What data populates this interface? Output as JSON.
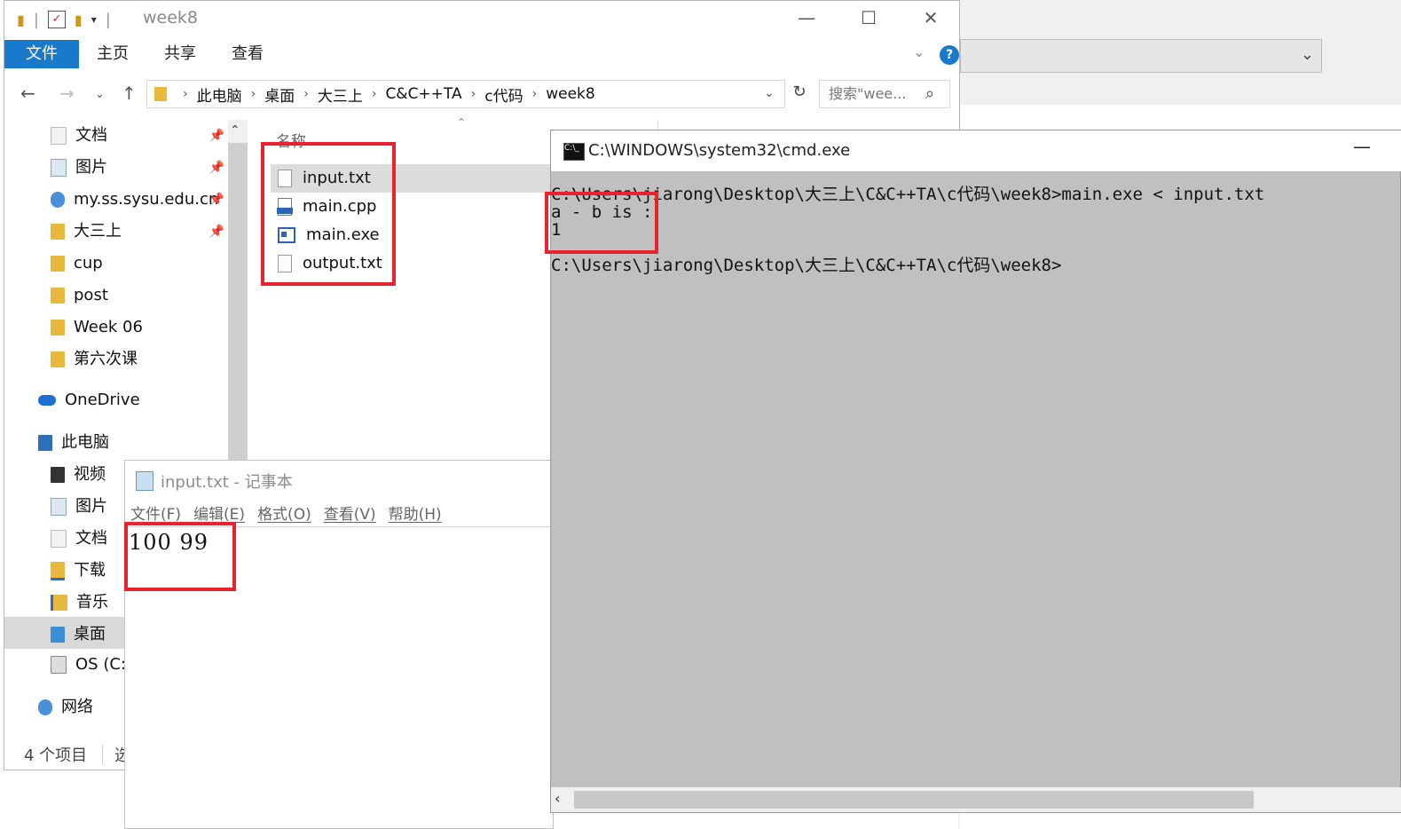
{
  "explorer": {
    "title": "week8",
    "ribbon_tabs": [
      "文件",
      "主页",
      "共享",
      "查看"
    ],
    "breadcrumb": [
      "此电脑",
      "桌面",
      "大三上",
      "C&C++TA",
      "c代码",
      "week8"
    ],
    "search_placeholder": "搜索\"wee...",
    "nav_items": [
      {
        "label": "文档",
        "icon": "documents-folder-icon",
        "pinned": true
      },
      {
        "label": "图片",
        "icon": "pictures-folder-icon",
        "pinned": true
      },
      {
        "label": "my.ss.sysu.edu.cn",
        "icon": "network-location-icon",
        "pinned": true
      },
      {
        "label": "大三上",
        "icon": "folder-icon",
        "pinned": true
      },
      {
        "label": "cup",
        "icon": "folder-icon"
      },
      {
        "label": "post",
        "icon": "folder-icon"
      },
      {
        "label": "Week 06",
        "icon": "folder-icon"
      },
      {
        "label": "第六次课",
        "icon": "folder-icon"
      },
      {
        "label": "OneDrive",
        "icon": "onedrive-icon"
      },
      {
        "label": "此电脑",
        "icon": "this-pc-icon"
      },
      {
        "label": "视频",
        "icon": "videos-folder-icon"
      },
      {
        "label": "图片",
        "icon": "pictures-folder-icon"
      },
      {
        "label": "文档",
        "icon": "documents-folder-icon"
      },
      {
        "label": "下载",
        "icon": "downloads-folder-icon"
      },
      {
        "label": "音乐",
        "icon": "music-folder-icon"
      },
      {
        "label": "桌面",
        "icon": "desktop-folder-icon",
        "selected": true
      },
      {
        "label": "OS (C:)",
        "icon": "drive-icon"
      },
      {
        "label": "网络",
        "icon": "network-icon"
      }
    ],
    "column_name": "名称",
    "files": [
      {
        "name": "input.txt",
        "icon": "text-file-icon"
      },
      {
        "name": "main.cpp",
        "icon": "cpp-file-icon"
      },
      {
        "name": "main.exe",
        "icon": "exe-file-icon"
      },
      {
        "name": "output.txt",
        "icon": "text-file-icon"
      }
    ],
    "status": "4 个项目",
    "status_extra": "选"
  },
  "notepad": {
    "title": "input.txt - 记事本",
    "menu": [
      "文件(F)",
      "编辑(E)",
      "格式(O)",
      "查看(V)",
      "帮助(H)"
    ],
    "content": "100 99"
  },
  "cmd": {
    "title": "C:\\WINDOWS\\system32\\cmd.exe",
    "lines": [
      "C:\\Users\\jiarong\\Desktop\\大三上\\C&C++TA\\c代码\\week8>main.exe < input.txt",
      "a - b is :",
      "1",
      "",
      "C:\\Users\\jiarong\\Desktop\\大三上\\C&C++TA\\c代码\\week8>"
    ]
  },
  "colors": {
    "accent": "#1979ca",
    "highlight_box": "#e8232f",
    "cmd_background": "#c0c0c0",
    "folder": "#e9b93e"
  }
}
